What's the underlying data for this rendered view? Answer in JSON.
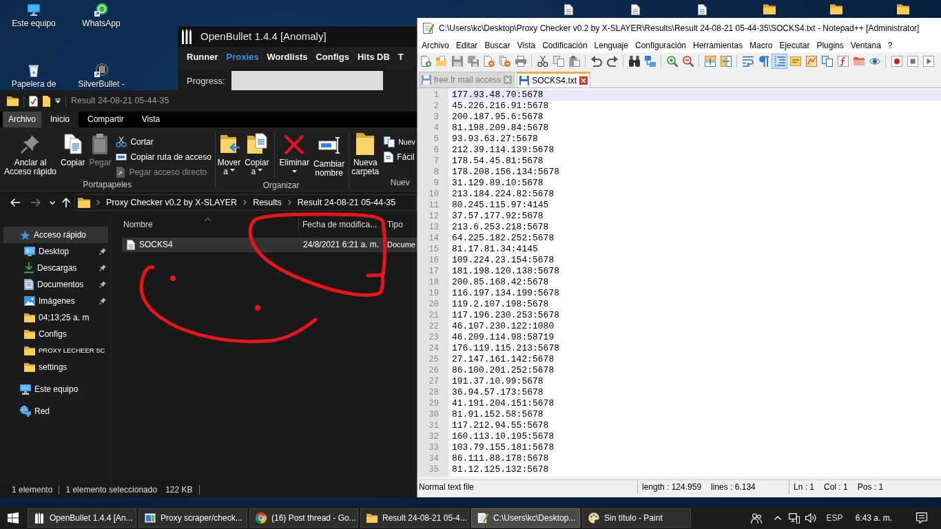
{
  "desktop": {
    "icons": [
      {
        "label": "Este equipo",
        "kind": "computer"
      },
      {
        "label": "WhatsApp",
        "kind": "whatsapp"
      },
      {
        "label": "Papelera de",
        "kind": "recycle"
      },
      {
        "label": "SilverBullet -",
        "kind": "shortcut"
      }
    ],
    "hidden_icons": [
      {
        "kind": "file"
      },
      {
        "kind": "file"
      },
      {
        "kind": "file"
      },
      {
        "kind": "folder"
      },
      {
        "kind": "folder"
      },
      {
        "kind": "folder"
      }
    ]
  },
  "openbullet": {
    "title": "OpenBullet 1.4.4 [Anomaly]",
    "menu": [
      {
        "label": "Runner",
        "selected": false
      },
      {
        "label": "Proxies",
        "selected": true
      },
      {
        "label": "Wordlists",
        "selected": false
      },
      {
        "label": "Configs",
        "selected": false
      },
      {
        "label": "Hits DB",
        "selected": false
      },
      {
        "label": "T",
        "selected": false
      }
    ],
    "progress": {
      "label": "Progress:",
      "level": 0
    }
  },
  "explorer": {
    "title": "Result 24-08-21 05-44-35",
    "ribbon_tabs": [
      {
        "label": "Archivo",
        "kind": "backstage",
        "selected": false
      },
      {
        "label": "Inicio",
        "kind": "tab",
        "selected": true
      },
      {
        "label": "Compartir",
        "kind": "tab",
        "selected": false
      },
      {
        "label": "Vista",
        "kind": "tab",
        "selected": false
      }
    ],
    "ribbon_groups": [
      {
        "label": "Portapapeles",
        "sets": [
          {
            "buttons": [
              {
                "label": "Anclar al\nAcceso rápido",
                "kind": "pin",
                "dropdown": false,
                "disabled": false
              },
              {
                "label": "Copiar",
                "kind": "copy",
                "dropdown": false,
                "disabled": false
              },
              {
                "label": "Pegar",
                "kind": "paste",
                "dropdown": false,
                "disabled": true
              }
            ],
            "small_buttons": [
              {
                "label": "Cortar",
                "kind": "cut",
                "dropdown": false,
                "disabled": false
              },
              {
                "label": "Copiar ruta de acceso",
                "kind": "copypath",
                "dropdown": false,
                "disabled": false
              },
              {
                "label": "Pegar acceso directo",
                "kind": "shortcut",
                "dropdown": false,
                "disabled": true
              }
            ]
          }
        ]
      },
      {
        "label": "Organizar",
        "sets": [
          {
            "buttons": [
              {
                "label": "Mover\na",
                "kind": "move",
                "dropdown": true,
                "disabled": false
              },
              {
                "label": "Copiar\na",
                "kind": "copyto",
                "dropdown": true,
                "disabled": false
              }
            ]
          },
          {
            "buttons": [
              {
                "label": "Eliminar",
                "kind": "delete",
                "dropdown": true,
                "disabled": false
              },
              {
                "label": "Cambiar\nnombre",
                "kind": "rename",
                "dropdown": false,
                "disabled": false
              }
            ]
          }
        ]
      },
      {
        "label": "Nuev",
        "sets": [
          {
            "buttons": [
              {
                "label": "Nueva\ncarpeta",
                "kind": "newfolder",
                "dropdown": false,
                "disabled": false
              }
            ],
            "small_buttons": [
              {
                "label": "Nuev",
                "kind": "newitem",
                "dropdown": false,
                "disabled": false
              },
              {
                "label": "Fácil",
                "kind": "easyaccess",
                "dropdown": false,
                "disabled": false
              }
            ]
          }
        ]
      }
    ],
    "nav_buttons": [
      {
        "kind": "back",
        "disabled": false
      },
      {
        "kind": "forward",
        "disabled": true
      },
      {
        "kind": "recent",
        "disabled": false
      },
      {
        "kind": "up",
        "disabled": false
      }
    ],
    "address": [
      "Proxy Checker v0.2 by X-SLAYER",
      "Results",
      "Result 24-08-21 05-44-35"
    ],
    "nav_pane": [
      {
        "label": "Acceso rápido",
        "kind": "quickaccess",
        "selected": true,
        "children": [
          {
            "label": "Desktop",
            "kind": "desktop",
            "selected": false,
            "pinned": true
          },
          {
            "label": "Descargas",
            "kind": "download",
            "selected": false,
            "pinned": true
          },
          {
            "label": "Documentos",
            "kind": "documents",
            "selected": false,
            "pinned": true
          },
          {
            "label": "Imágenes",
            "kind": "pictures",
            "selected": false,
            "pinned": true
          },
          {
            "label": "04;13;25 a. m",
            "kind": "folder",
            "selected": false,
            "pinned": false
          },
          {
            "label": "Configs",
            "kind": "folder",
            "selected": false,
            "pinned": false
          },
          {
            "label": "PROXY LECHEER SC",
            "kind": "folder",
            "selected": false,
            "pinned": false
          },
          {
            "label": "settings",
            "kind": "folder",
            "selected": false,
            "pinned": false
          }
        ]
      },
      {
        "label": "Este equipo",
        "kind": "computer",
        "selected": false
      },
      {
        "label": "Red",
        "kind": "network",
        "selected": false
      }
    ],
    "columns": [
      {
        "label": "Nombre",
        "sorted": true
      },
      {
        "label": "Fecha de modifica...",
        "sorted": false
      },
      {
        "label": "Tipo",
        "sorted": false
      }
    ],
    "rows": [
      {
        "name": "SOCKS4",
        "date": "24/8/2021 6:21 a. m.",
        "type": "Docume",
        "selected": true
      }
    ],
    "status": {
      "items": "1 elemento",
      "selection": "1 elemento seleccionado",
      "size": "122 KB"
    }
  },
  "annotation": {
    "kind": "freehand"
  },
  "notepad": {
    "title": "C:\\Users\\kc\\Desktop\\Proxy Checker v0.2 by X-SLAYER\\Results\\Result 24-08-21 05-44-35\\SOCKS4.txt - Notepad++ [Administrator]",
    "menu": [
      "Archivo",
      "Editar",
      "Buscar",
      "Vista",
      "Codificación",
      "Lenguaje",
      "Configuración",
      "Herramientas",
      "Macro",
      "Ejecutar",
      "Plugins",
      "Ventana",
      "?"
    ],
    "toolbar": [
      [
        {
          "kind": "new",
          "pressed": false
        },
        {
          "kind": "open",
          "pressed": false
        },
        {
          "kind": "save",
          "pressed": false
        },
        {
          "kind": "saveall",
          "pressed": false
        },
        {
          "kind": "close",
          "pressed": false
        },
        {
          "kind": "closeall",
          "pressed": false
        },
        {
          "kind": "print",
          "pressed": false
        }
      ],
      [
        {
          "kind": "cut",
          "pressed": false
        },
        {
          "kind": "copy",
          "pressed": false
        },
        {
          "kind": "paste",
          "pressed": false
        }
      ],
      [
        {
          "kind": "undo",
          "pressed": false
        },
        {
          "kind": "redo",
          "pressed": false
        }
      ],
      [
        {
          "kind": "find",
          "pressed": false
        },
        {
          "kind": "replace",
          "pressed": false
        }
      ],
      [
        {
          "kind": "zoomin",
          "pressed": false
        },
        {
          "kind": "zoomout",
          "pressed": false
        }
      ],
      [
        {
          "kind": "syncv",
          "pressed": false
        },
        {
          "kind": "synch",
          "pressed": false
        }
      ],
      [
        {
          "kind": "wrap",
          "pressed": false
        },
        {
          "kind": "allchars",
          "pressed": false
        },
        {
          "kind": "indent",
          "pressed": true
        },
        {
          "kind": "udl",
          "pressed": false
        },
        {
          "kind": "docmap",
          "pressed": false
        },
        {
          "kind": "doclist",
          "pressed": false
        },
        {
          "kind": "funclist",
          "pressed": false
        },
        {
          "kind": "folderws",
          "pressed": false
        },
        {
          "kind": "monitor",
          "pressed": false
        }
      ],
      [
        {
          "kind": "record",
          "pressed": false
        },
        {
          "kind": "stop",
          "pressed": false
        },
        {
          "kind": "play",
          "pressed": false
        }
      ]
    ],
    "tabs": [
      {
        "label": "free.fr mail access",
        "selected": false
      },
      {
        "label": "SOCKS4.txt",
        "selected": true
      }
    ],
    "lines": [
      {
        "number": "1",
        "text": "177.93.48.70:5678",
        "current": true
      },
      {
        "number": "2",
        "text": "45.226.216.91:5678",
        "current": false
      },
      {
        "number": "3",
        "text": "200.187.95.6:5678",
        "current": false
      },
      {
        "number": "4",
        "text": "81.198.209.84:5678",
        "current": false
      },
      {
        "number": "5",
        "text": "93.93.63.27:5678",
        "current": false
      },
      {
        "number": "6",
        "text": "212.39.114.139:5678",
        "current": false
      },
      {
        "number": "7",
        "text": "178.54.45.81:5678",
        "current": false
      },
      {
        "number": "8",
        "text": "178.208.156.134:5678",
        "current": false
      },
      {
        "number": "9",
        "text": "31.129.89.10:5678",
        "current": false
      },
      {
        "number": "10",
        "text": "213.184.224.82:5678",
        "current": false
      },
      {
        "number": "11",
        "text": "80.245.115.97:4145",
        "current": false
      },
      {
        "number": "12",
        "text": "37.57.177.92:5678",
        "current": false
      },
      {
        "number": "13",
        "text": "213.6.253.218:5678",
        "current": false
      },
      {
        "number": "14",
        "text": "64.225.182.252:5678",
        "current": false
      },
      {
        "number": "15",
        "text": "81.17.81.34:4145",
        "current": false
      },
      {
        "number": "16",
        "text": "109.224.23.154:5678",
        "current": false
      },
      {
        "number": "17",
        "text": "181.198.120.138:5678",
        "current": false
      },
      {
        "number": "18",
        "text": "200.85.168.42:5678",
        "current": false
      },
      {
        "number": "19",
        "text": "116.197.134.199:5678",
        "current": false
      },
      {
        "number": "20",
        "text": "119.2.107.198:5678",
        "current": false
      },
      {
        "number": "21",
        "text": "117.196.230.253:5678",
        "current": false
      },
      {
        "number": "22",
        "text": "46.107.230.122:1080",
        "current": false
      },
      {
        "number": "23",
        "text": "46.209.114.98:58719",
        "current": false
      },
      {
        "number": "24",
        "text": "176.119.115.213:5678",
        "current": false
      },
      {
        "number": "25",
        "text": "27.147.161.142:5678",
        "current": false
      },
      {
        "number": "26",
        "text": "86.100.201.252:5678",
        "current": false
      },
      {
        "number": "27",
        "text": "191.37.10.99:5678",
        "current": false
      },
      {
        "number": "28",
        "text": "36.94.57.173:5678",
        "current": false
      },
      {
        "number": "29",
        "text": "41.191.204.151:5678",
        "current": false
      },
      {
        "number": "30",
        "text": "81.91.152.58:5678",
        "current": false
      },
      {
        "number": "31",
        "text": "117.212.94.55:5678",
        "current": false
      },
      {
        "number": "32",
        "text": "160.113.10.195:5678",
        "current": false
      },
      {
        "number": "33",
        "text": "103.79.155.181:5678",
        "current": false
      },
      {
        "number": "34",
        "text": "86.111.88.178:5678",
        "current": false
      },
      {
        "number": "35",
        "text": "81.12.125.132:5678",
        "current": false
      }
    ],
    "status": {
      "file_type": "Normal text file",
      "length": "length : 124.959",
      "lines": "lines : 6.134",
      "line": "Ln : 1",
      "column": "Col : 1",
      "position": "Pos : 1"
    }
  },
  "taskbar": {
    "buttons": [
      {
        "label": "OpenBullet 1.4.4 [An...",
        "kind": "bullets",
        "selected": false
      },
      {
        "label": "Proxy scraper/check...",
        "kind": "app",
        "selected": false
      },
      {
        "label": "(16) Post thread - Go...",
        "kind": "browser",
        "selected": false
      },
      {
        "label": "Result 24-08-21 05-4...",
        "kind": "folder",
        "selected": false
      },
      {
        "label": "C:\\Users\\kc\\Desktop...",
        "kind": "notepad",
        "selected": true
      },
      {
        "label": "Sin título - Paint",
        "kind": "paint",
        "selected": false
      }
    ],
    "language": "ESP",
    "time": "6:43 a. m."
  }
}
